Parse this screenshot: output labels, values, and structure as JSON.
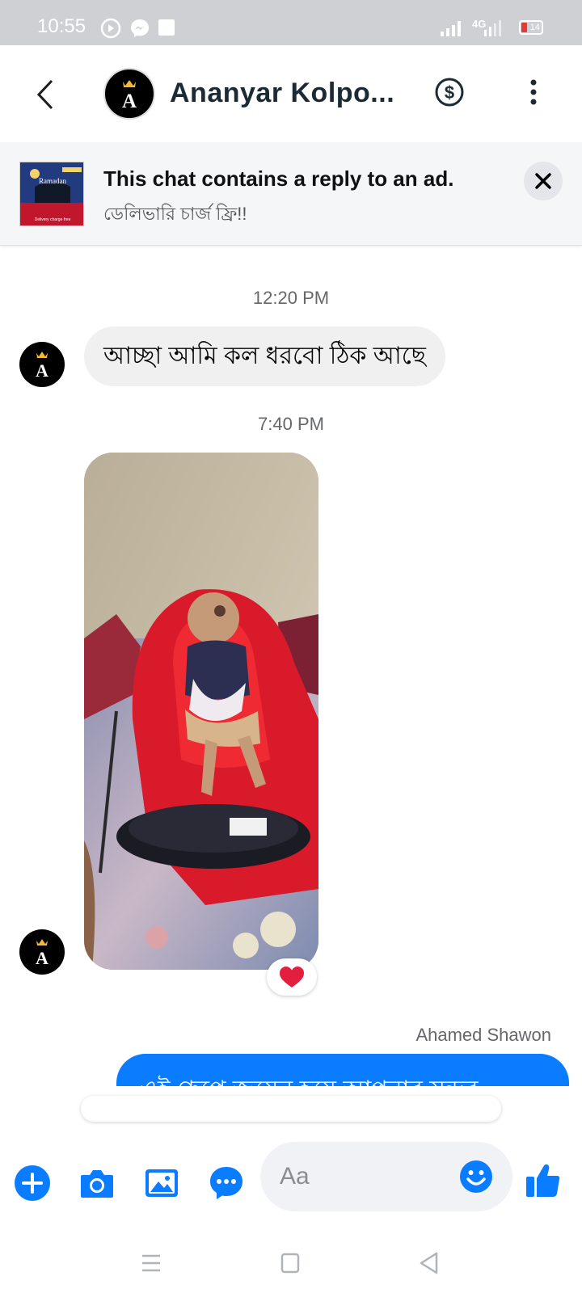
{
  "status_bar": {
    "time": "10:55",
    "network": "4G",
    "battery": "14",
    "icons": [
      "media-icon",
      "messenger-icon",
      "square-icon",
      "signal-icon",
      "battery-icon"
    ]
  },
  "header": {
    "title": "Ananyar Kolpo...",
    "avatar_letter": "A",
    "icons": [
      "back-icon",
      "dollar-icon",
      "more-icon"
    ]
  },
  "ad_banner": {
    "title": "This chat contains a reply to an ad.",
    "subtitle": "ডেলিভারি চার্জ ফ্রি!!",
    "thumb_text": "Ramadan",
    "thumb_caption": "Delivery charge free",
    "close_icon": "close-icon"
  },
  "messages": {
    "timestamp_1": "12:20 PM",
    "incoming_text": "আচ্ছা আমি কল ধরবো ঠিক আছে",
    "timestamp_2": "7:40 PM",
    "photo_reaction": "heart",
    "sender_name": "Ahamed Shawon",
    "outgoing_text": "এই গ্রুপে জয়েন হয়ে আপনার সুন্দর"
  },
  "composer": {
    "placeholder": "Aa",
    "icons": [
      "add-icon",
      "camera-icon",
      "gallery-icon",
      "chat-bubble-icon",
      "emoji-icon",
      "like-icon"
    ]
  },
  "colors": {
    "accent": "#0a7cff",
    "incoming_bubble": "#f0f0f0",
    "status_bar": "#cfd0d4",
    "reaction": "#e41e3f"
  }
}
